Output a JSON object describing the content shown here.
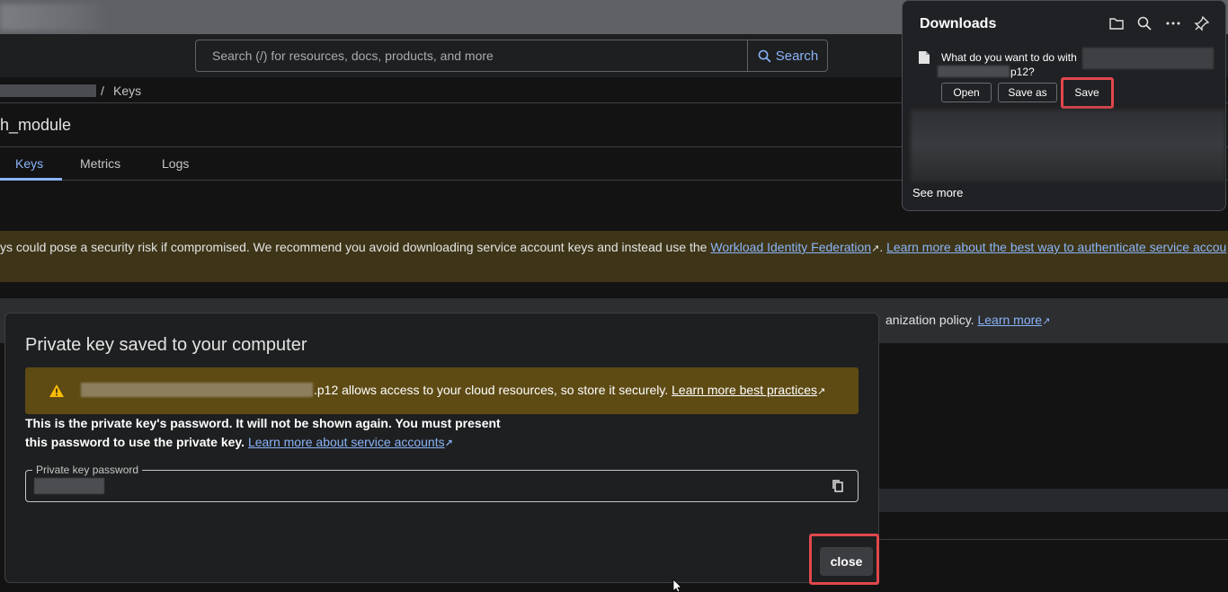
{
  "header": {
    "search_placeholder": "Search (/) for resources, docs, products, and more",
    "search_button": "Search"
  },
  "breadcrumb": {
    "separator": "/",
    "current": "Keys"
  },
  "page": {
    "title": "h_module"
  },
  "tabs": [
    {
      "label": "Keys",
      "active": true
    },
    {
      "label": "Metrics",
      "active": false
    },
    {
      "label": "Logs",
      "active": false
    }
  ],
  "warning_banner": {
    "text": "ys could pose a security risk if compromised. We recommend you avoid downloading service account keys and instead use the",
    "link1": "Workload Identity Federation",
    "sep": ".",
    "link2": "Learn more about the best way to authenticate service accou"
  },
  "info_band": {
    "text": "anization policy.",
    "link": "Learn more"
  },
  "dialog": {
    "title": "Private key saved to your computer",
    "warning_suffix": ".p12 allows access to your cloud resources, so store it securely.",
    "warning_link": "Learn more best practices",
    "desc_bold": "This is the private key's password. It will not be shown again. You must present this password to use the private key.",
    "desc_link": "Learn more about service accounts",
    "password_label": "Private key password",
    "close_button": "close"
  },
  "downloads": {
    "title": "Downloads",
    "question": "What do you want to do with",
    "file_ext": "p12?",
    "open_button": "Open",
    "save_as_button": "Save as",
    "save_button": "Save",
    "see_more": "See more"
  },
  "colors": {
    "accent": "#8ab4f8",
    "highlight": "#e0474c",
    "warning_bg": "#5e4b14"
  }
}
